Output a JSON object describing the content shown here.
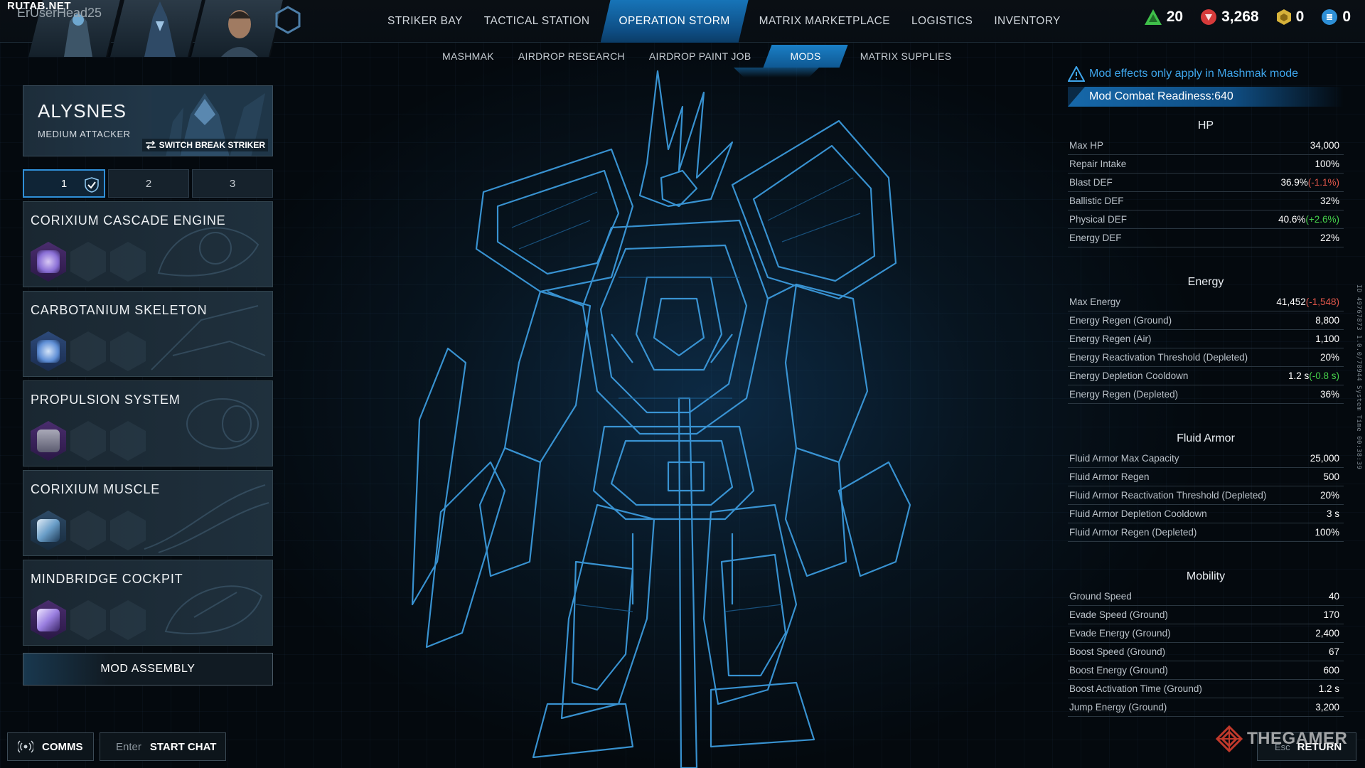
{
  "brand": "RUTAB.NET",
  "player": {
    "name": "ErUserHead25"
  },
  "main_nav": [
    {
      "label": "STRIKER BAY",
      "active": false
    },
    {
      "label": "TACTICAL STATION",
      "active": false
    },
    {
      "label": "OPERATION STORM",
      "active": true
    },
    {
      "label": "MATRIX MARKETPLACE",
      "active": false
    },
    {
      "label": "LOGISTICS",
      "active": false
    },
    {
      "label": "INVENTORY",
      "active": false
    }
  ],
  "currencies": [
    {
      "icon": "green-triangle-icon",
      "value": "20",
      "color": "#3fbf4a"
    },
    {
      "icon": "red-crest-icon",
      "value": "3,268",
      "color": "#d63a3a"
    },
    {
      "icon": "gold-hexagon-icon",
      "value": "0",
      "color": "#d6b23a"
    },
    {
      "icon": "blue-coin-icon",
      "value": "0",
      "color": "#2e8fd6"
    }
  ],
  "sub_nav": [
    {
      "label": "MASHMAK",
      "active": false
    },
    {
      "label": "AIRDROP RESEARCH",
      "active": false
    },
    {
      "label": "AIRDROP PAINT JOB",
      "active": false
    },
    {
      "label": "MODS",
      "active": true
    },
    {
      "label": "MATRIX SUPPLIES",
      "active": false
    }
  ],
  "striker": {
    "name": "ALYSNES",
    "class": "MEDIUM ATTACKER",
    "switch_label": "SWITCH BREAK STRIKER"
  },
  "slot_tabs": [
    {
      "label": "1",
      "active": true
    },
    {
      "label": "2",
      "active": false
    },
    {
      "label": "3",
      "active": false
    }
  ],
  "mods": [
    {
      "title": "CORIXIUM CASCADE ENGINE",
      "icon": "engine-mod-icon",
      "color": "#8a6fd6"
    },
    {
      "title": "CARBOTANIUM SKELETON",
      "icon": "skeleton-mod-icon",
      "color": "#5f8fd6"
    },
    {
      "title": "PROPULSION SYSTEM",
      "icon": "propulsion-mod-icon",
      "color": "#7b74c9"
    },
    {
      "title": "CORIXIUM MUSCLE",
      "icon": "muscle-mod-icon",
      "color": "#6a9ec8"
    },
    {
      "title": "MINDBRIDGE COCKPIT",
      "icon": "cockpit-mod-icon",
      "color": "#9a7fe0"
    }
  ],
  "mod_assembly": "MOD ASSEMBLY",
  "comms": {
    "label": "COMMS"
  },
  "chat": {
    "key": "Enter",
    "label": "START CHAT"
  },
  "stats": {
    "warning": "Mod effects only apply in Mashmak mode",
    "readiness": "Mod Combat Readiness:640",
    "sections": [
      {
        "title": "HP",
        "rows": [
          {
            "label": "Max HP",
            "value": "34,000",
            "delta": "",
            "delta_type": ""
          },
          {
            "label": "Repair Intake",
            "value": "100%",
            "delta": "",
            "delta_type": ""
          },
          {
            "label": "Blast DEF",
            "value": "36.9%",
            "delta": "(-1.1%)",
            "delta_type": "neg"
          },
          {
            "label": "Ballistic DEF",
            "value": "32%",
            "delta": "",
            "delta_type": ""
          },
          {
            "label": "Physical DEF",
            "value": "40.6%",
            "delta": "(+2.6%)",
            "delta_type": "pos"
          },
          {
            "label": "Energy DEF",
            "value": "22%",
            "delta": "",
            "delta_type": ""
          }
        ]
      },
      {
        "title": "Energy",
        "rows": [
          {
            "label": "Max Energy",
            "value": "41,452",
            "delta": "(-1,548)",
            "delta_type": "neg"
          },
          {
            "label": "Energy Regen (Ground)",
            "value": "8,800",
            "delta": "",
            "delta_type": ""
          },
          {
            "label": "Energy Regen (Air)",
            "value": "1,100",
            "delta": "",
            "delta_type": ""
          },
          {
            "label": "Energy Reactivation Threshold (Depleted)",
            "value": "20%",
            "delta": "",
            "delta_type": ""
          },
          {
            "label": "Energy Depletion Cooldown",
            "value": "1.2 s",
            "delta": "(-0.8 s)",
            "delta_type": "pos"
          },
          {
            "label": "Energy Regen (Depleted)",
            "value": "36%",
            "delta": "",
            "delta_type": ""
          }
        ]
      },
      {
        "title": "Fluid Armor",
        "rows": [
          {
            "label": "Fluid Armor Max Capacity",
            "value": "25,000",
            "delta": "",
            "delta_type": ""
          },
          {
            "label": "Fluid Armor Regen",
            "value": "500",
            "delta": "",
            "delta_type": ""
          },
          {
            "label": "Fluid Armor Reactivation Threshold (Depleted)",
            "value": "20%",
            "delta": "",
            "delta_type": ""
          },
          {
            "label": "Fluid Armor Depletion Cooldown",
            "value": "3 s",
            "delta": "",
            "delta_type": ""
          },
          {
            "label": "Fluid Armor Regen (Depleted)",
            "value": "100%",
            "delta": "",
            "delta_type": ""
          }
        ]
      },
      {
        "title": "Mobility",
        "rows": [
          {
            "label": "Ground Speed",
            "value": "40",
            "delta": "",
            "delta_type": ""
          },
          {
            "label": "Evade Speed (Ground)",
            "value": "170",
            "delta": "",
            "delta_type": ""
          },
          {
            "label": "Evade Energy (Ground)",
            "value": "2,400",
            "delta": "",
            "delta_type": ""
          },
          {
            "label": "Boost Speed (Ground)",
            "value": "67",
            "delta": "",
            "delta_type": ""
          },
          {
            "label": "Boost Energy (Ground)",
            "value": "600",
            "delta": "",
            "delta_type": ""
          },
          {
            "label": "Boost Activation Time (Ground)",
            "value": "1.2 s",
            "delta": "",
            "delta_type": ""
          },
          {
            "label": "Jump Energy (Ground)",
            "value": "3,200",
            "delta": "",
            "delta_type": ""
          }
        ]
      }
    ]
  },
  "side_id": "ID 49767873  1.0.0/78944  System Time  00:38:39",
  "return_btn": {
    "key": "Esc",
    "label": "RETURN"
  },
  "watermark": "THEGAMER",
  "colors": {
    "accent": "#1a7fc6",
    "panel": "#1a2731",
    "warning": "#3fa6ec"
  }
}
